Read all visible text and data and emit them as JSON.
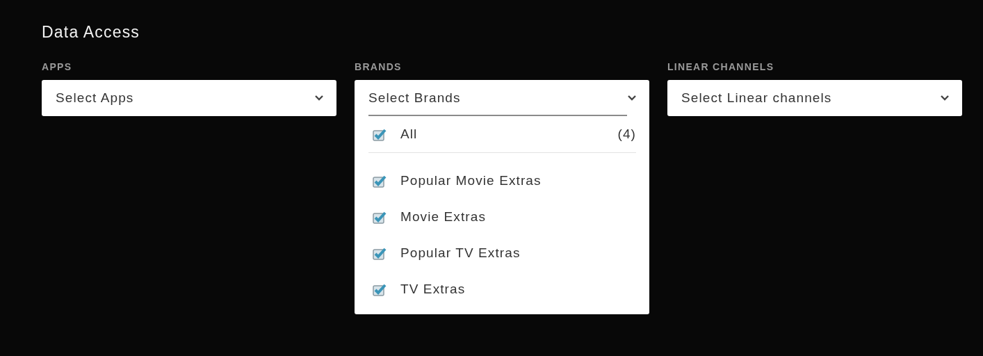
{
  "section": {
    "title": "Data Access"
  },
  "filters": [
    {
      "label": "APPS",
      "placeholder": "Select Apps",
      "expanded": false
    },
    {
      "label": "BRANDS",
      "placeholder": "Select Brands",
      "expanded": true,
      "all_option": {
        "label": "All",
        "count": "(4)",
        "checked": true
      },
      "options": [
        {
          "label": "Popular Movie Extras",
          "checked": true
        },
        {
          "label": "Movie Extras",
          "checked": true
        },
        {
          "label": "Popular TV Extras",
          "checked": true
        },
        {
          "label": "TV Extras",
          "checked": true
        }
      ]
    },
    {
      "label": "LINEAR CHANNELS",
      "placeholder": "Select Linear channels",
      "expanded": false
    }
  ]
}
